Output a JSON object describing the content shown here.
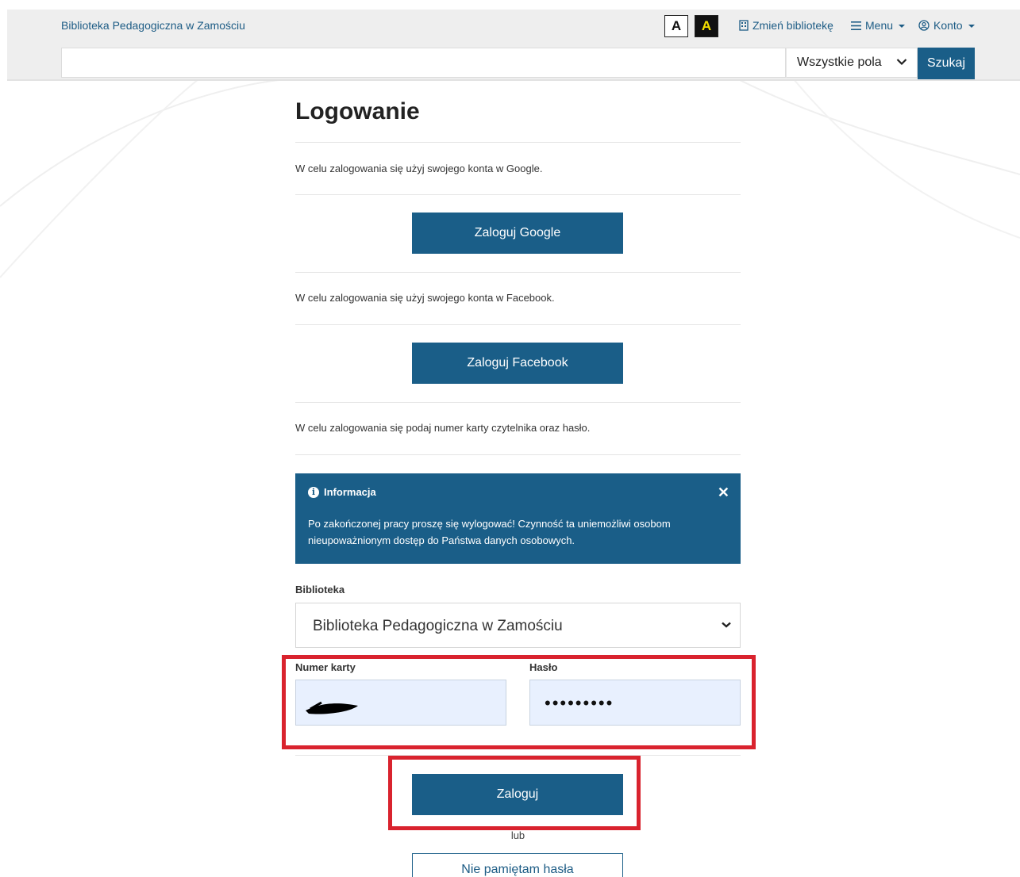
{
  "header": {
    "brand": "Biblioteka Pedagogiczna w Zamościu",
    "contrast_normal": "A",
    "contrast_high": "A",
    "change_library": "Zmień bibliotekę",
    "menu": "Menu",
    "account": "Konto"
  },
  "search": {
    "value": "",
    "field": "Wszystkie pola",
    "button": "Szukaj"
  },
  "login": {
    "title": "Logowanie",
    "google_text": "W celu zalogowania się użyj swojego konta w Google.",
    "google_button": "Zaloguj Google",
    "facebook_text": "W celu zalogowania się użyj swojego konta w Facebook.",
    "facebook_button": "Zaloguj Facebook",
    "card_text": "W celu zalogowania się podaj numer karty czytelnika oraz hasło.",
    "alert_title": "Informacja",
    "alert_body": "Po zakończonej pracy proszę się wylogować! Czynność ta uniemożliwi osobom nieupoważnionym dostęp do Państwa danych osobowych.",
    "library_label": "Biblioteka",
    "library_value": "Biblioteka Pedagogiczna w Zamościu",
    "card_label": "Numer karty",
    "password_label": "Hasło",
    "password_value": "•••••••••",
    "submit_button": "Zaloguj",
    "or_text": "lub",
    "forgot_button": "Nie pamiętam hasła"
  },
  "colors": {
    "primary": "#1a5e88",
    "highlight": "#d9232e",
    "autofill": "#e8f0fe"
  }
}
